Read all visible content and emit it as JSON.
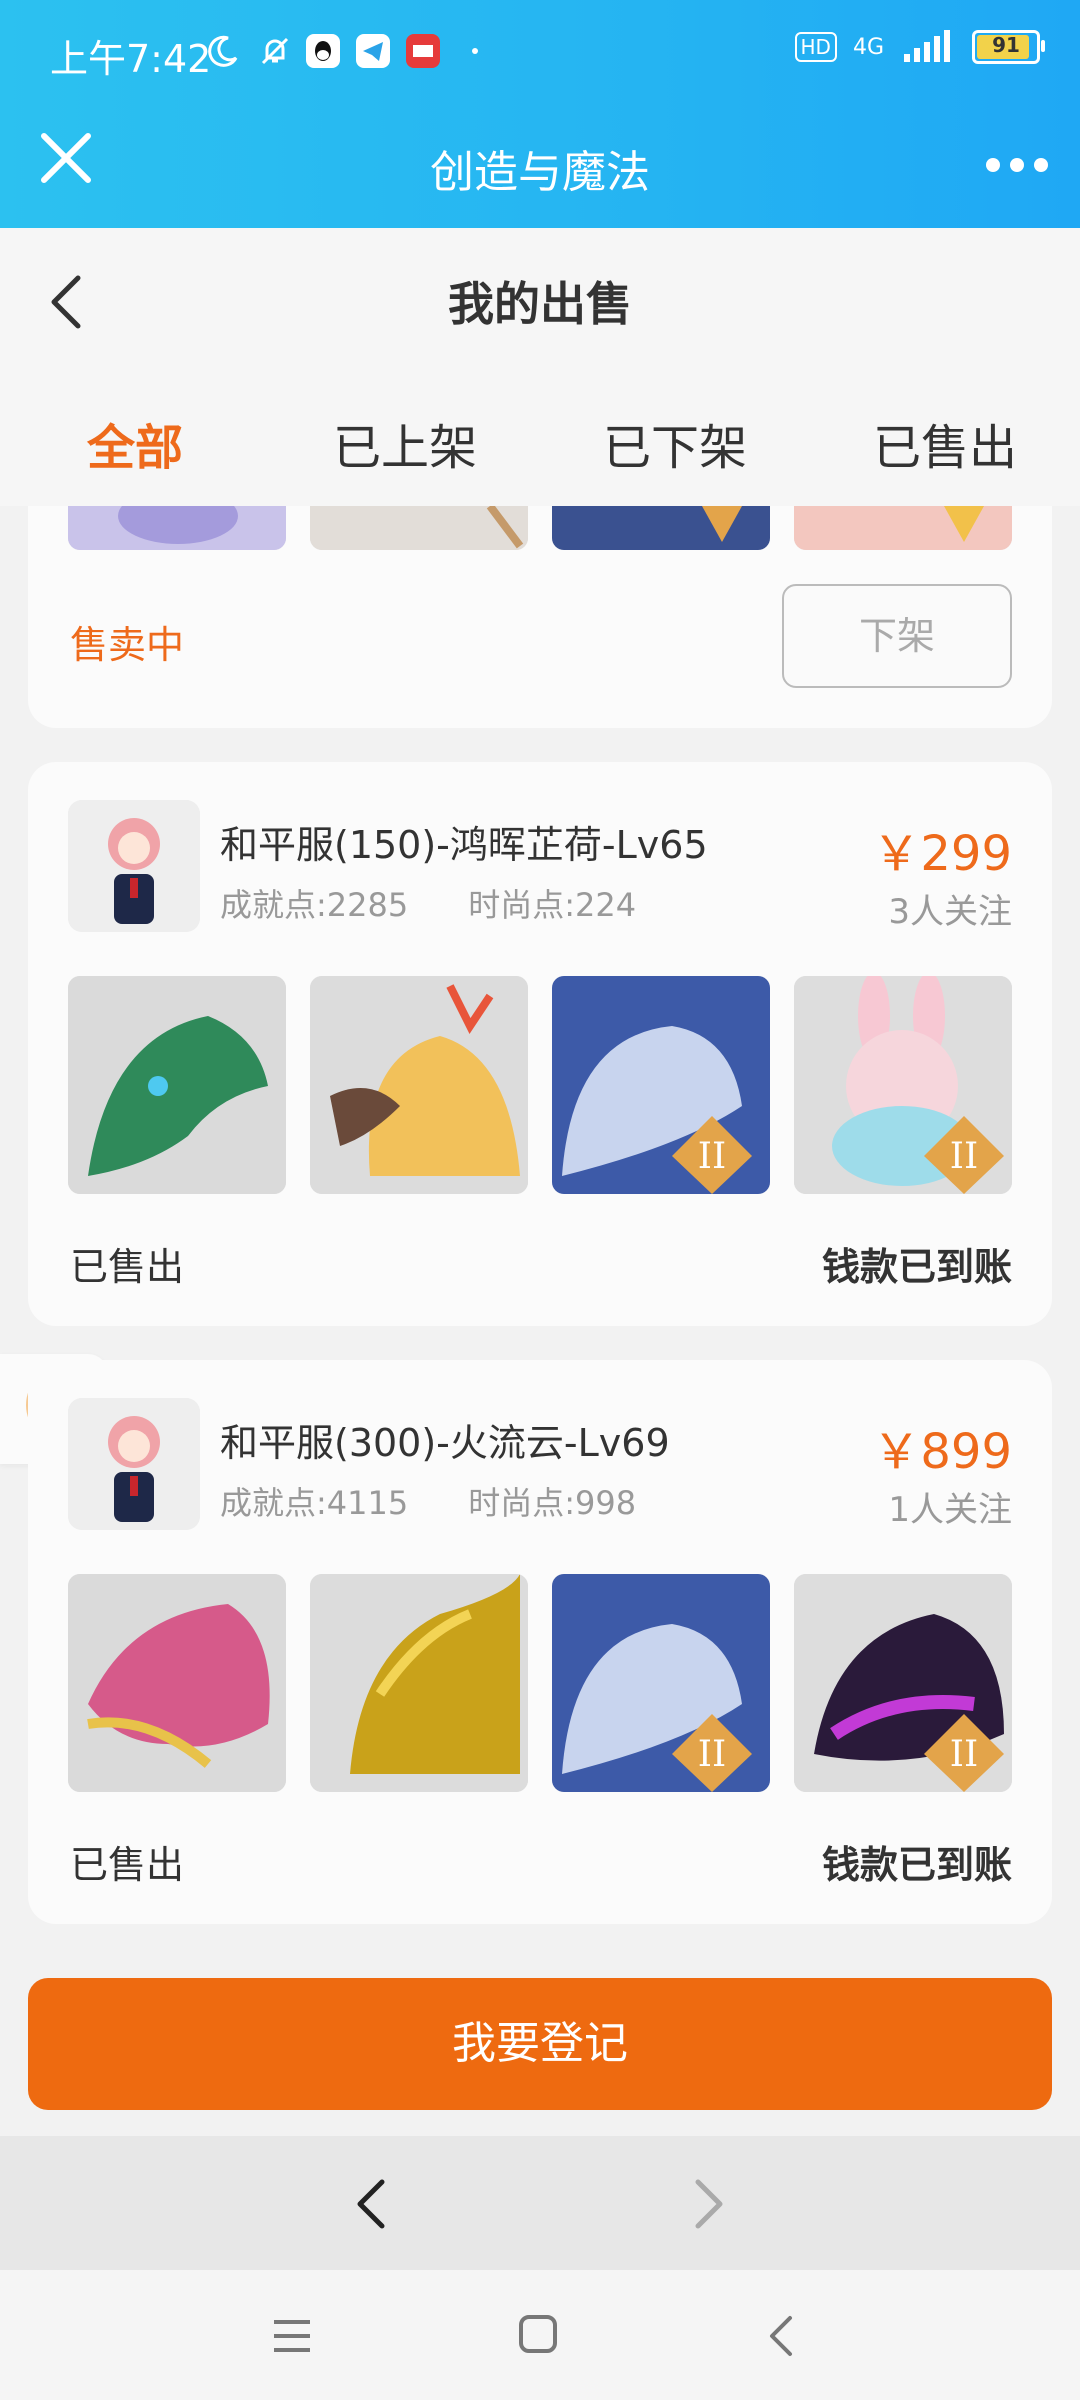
{
  "status_bar": {
    "time": "上午7:42",
    "battery": "91",
    "network": "4G"
  },
  "app_bar": {
    "title": "创造与魔法"
  },
  "page": {
    "title": "我的出售"
  },
  "tabs": [
    {
      "label": "全部",
      "active": true
    },
    {
      "label": "已上架",
      "active": false
    },
    {
      "label": "已下架",
      "active": false
    },
    {
      "label": "已售出",
      "active": false
    }
  ],
  "card0": {
    "status": "售卖中",
    "action": "下架"
  },
  "card1": {
    "name": "和平服(150)-鸿晖芷荷-Lv65",
    "achievement": "成就点:2285",
    "fashion": "时尚点:224",
    "price": "￥299",
    "followers": "3人关注",
    "status": "已售出",
    "settlement": "钱款已到账",
    "thumbs": [
      "green-dragon-icon",
      "phoenix-bird-icon",
      "white-tiger-icon",
      "pink-rabbit-icon"
    ]
  },
  "card2": {
    "name": "和平服(300)-火流云-Lv69",
    "achievement": "成就点:4115",
    "fashion": "时尚点:998",
    "price": "￥899",
    "followers": "1人关注",
    "status": "已售出",
    "settlement": "钱款已到账",
    "thumbs": [
      "pink-dragon-icon",
      "golden-dragon-icon",
      "white-tiger-icon",
      "purple-beast-icon"
    ]
  },
  "register_button": "我要登记",
  "colors": {
    "accent": "#ee6a1b",
    "header": "#25b4f2"
  }
}
